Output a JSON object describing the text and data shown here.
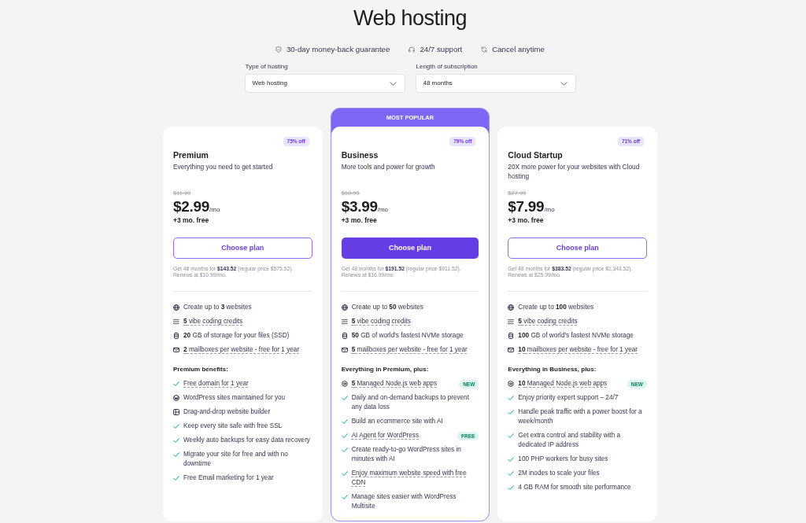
{
  "page": {
    "title": "Web hosting"
  },
  "guarantees": [
    {
      "kind": "money_back",
      "text": "30-day money-back guarantee"
    },
    {
      "kind": "support",
      "text": "24/7 support"
    },
    {
      "kind": "cancel",
      "text": "Cancel anytime"
    }
  ],
  "filters": [
    {
      "label": "Type of hosting",
      "value": "Web hosting"
    },
    {
      "label": "Length of subscription",
      "value": "48 months"
    }
  ],
  "plans": [
    {
      "name": "Premium",
      "description": "Everything you need to get started",
      "discount": "75% off",
      "old_price": "$11.99",
      "price": "$2.99",
      "period": "/mo",
      "bonus": "+3 mo. free",
      "button": "Choose plan",
      "featured": false,
      "note": "Get 48 months for **$143.52** (regular price $575.52). Renews at $10.99/mo.",
      "features": [
        {
          "kind": "websites",
          "text": "Create up to **3** websites",
          "tooltip": false
        },
        {
          "kind": "credits",
          "text": "**5** vibe coding credits",
          "tooltip": true
        },
        {
          "kind": "storage",
          "text": "**20** GB of storage for your files (SSD)",
          "tooltip": false
        },
        {
          "kind": "email",
          "text": "**2** mailboxes per website - free for 1 year",
          "tooltip": true
        }
      ],
      "benefits_title": "Premium benefits:",
      "benefits": [
        {
          "kind": "check",
          "text": "Free domain for 1 year",
          "tooltip": true
        },
        {
          "kind": "wordpress",
          "text": "WordPress sites maintained for you",
          "tooltip": false
        },
        {
          "kind": "builder",
          "text": "Drag-and-drop website builder",
          "tooltip": false
        },
        {
          "kind": "check",
          "text": "Keep every site safe with free SSL",
          "tooltip": false
        },
        {
          "kind": "check",
          "text": "Weekly auto backups for easy data recovery",
          "tooltip": false
        },
        {
          "kind": "check",
          "text": "Migrate your site for free and with no downtime",
          "tooltip": false
        },
        {
          "kind": "check",
          "text": "Free Email marketing for 1 year",
          "tooltip": false
        }
      ]
    },
    {
      "ribbon": "MOST POPULAR",
      "name": "Business",
      "description": "More tools and power for growth",
      "discount": "79% off",
      "old_price": "$18.99",
      "price": "$3.99",
      "period": "/mo",
      "bonus": "+3 mo. free",
      "button": "Choose plan",
      "featured": true,
      "note": "Get 48 months for **$191.52** (regular price $911.52). Renews at $16.99/mo.",
      "features": [
        {
          "kind": "websites",
          "text": "Create up to **50** websites",
          "tooltip": false
        },
        {
          "kind": "credits",
          "text": "**5** vibe coding credits",
          "tooltip": true
        },
        {
          "kind": "storage",
          "text": "**50** GB of world's fastest NVMe storage",
          "tooltip": false
        },
        {
          "kind": "email",
          "text": "**5** mailboxes per website - free for 1 year",
          "tooltip": true
        }
      ],
      "benefits_title": "Everything in Premium, plus:",
      "benefits": [
        {
          "kind": "nodejs",
          "text": "**5** Managed Node.js web apps",
          "tooltip": true,
          "badge": "NEW"
        },
        {
          "kind": "check",
          "text": "Daily and on-demand backups to prevent any data loss",
          "tooltip": false
        },
        {
          "kind": "check",
          "text": "Build an ecommerce site with AI",
          "tooltip": false
        },
        {
          "kind": "check",
          "text": "AI Agent for WordPress",
          "tooltip": true,
          "badge": "FREE"
        },
        {
          "kind": "check",
          "text": "Create ready-to-go WordPress sites in minutes with AI",
          "tooltip": false
        },
        {
          "kind": "check",
          "text": "Enjoy maximum website speed with free CDN",
          "tooltip": true
        },
        {
          "kind": "check",
          "text": "Manage sites easier with WordPress Multisite",
          "tooltip": false
        }
      ]
    },
    {
      "name": "Cloud Startup",
      "description": "20X more power for your websites with Cloud hosting",
      "discount": "71% off",
      "old_price": "$27.99",
      "price": "$7.99",
      "period": "/mo",
      "bonus": "+3 mo. free",
      "button": "Choose plan",
      "featured": false,
      "note": "Get 48 months for **$383.52** (regular price $1,343.52). Renews at $25.99/mo.",
      "features": [
        {
          "kind": "websites",
          "text": "Create up to **100** websites",
          "tooltip": false
        },
        {
          "kind": "credits",
          "text": "**5** vibe coding credits",
          "tooltip": true
        },
        {
          "kind": "storage",
          "text": "**100** GB of world's fastest NVMe storage",
          "tooltip": false
        },
        {
          "kind": "email",
          "text": "**10** mailboxes per website - free for 1 year",
          "tooltip": true
        }
      ],
      "benefits_title": "Everything in Business, plus:",
      "benefits": [
        {
          "kind": "nodejs",
          "text": "**10** Managed Node.js web apps",
          "tooltip": true,
          "badge": "NEW"
        },
        {
          "kind": "check",
          "text": "Enjoy priority expert support – 24/7",
          "tooltip": false
        },
        {
          "kind": "check",
          "text": "Handle peak traffic with a power boost for a week/month",
          "tooltip": false
        },
        {
          "kind": "check",
          "text": "Get extra control and stability with a dedicated IP address",
          "tooltip": false
        },
        {
          "kind": "check",
          "text": "100 PHP workers for busy sites",
          "tooltip": false
        },
        {
          "kind": "check",
          "text": "2M inodes to scale your files",
          "tooltip": false
        },
        {
          "kind": "check",
          "text": "4 GB RAM for smooth site performance",
          "tooltip": false
        }
      ]
    }
  ]
}
